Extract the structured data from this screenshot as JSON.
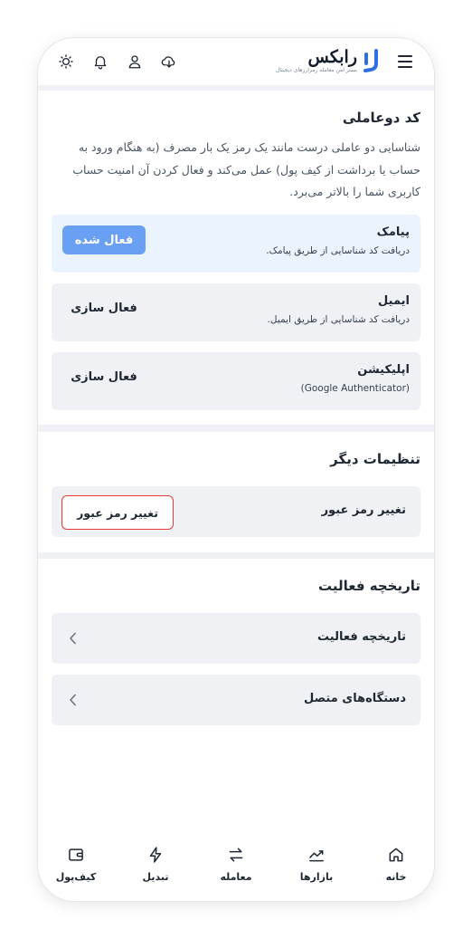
{
  "header": {
    "logo_text": "رابکس",
    "logo_subtitle": "بستر امن معامله رمزارزهای دیجیتال",
    "icons": [
      "theme-icon",
      "bell-icon",
      "user-icon",
      "cloud-download-icon",
      "hamburger-menu-icon"
    ]
  },
  "two_factor": {
    "title": "کد دوعاملی",
    "description": "شناسایی دو عاملی درست مانند یک رمز یک بار مصرف (به هنگام ورود به حساب یا برداشت از کیف پول) عمل می‌کند و فعال کردن آن امنیت حساب کاربری شما را بالاتر می‌برد.",
    "methods": [
      {
        "title": "پیامک",
        "subtitle": "دریافت کد شناسایی از طریق پیامک.",
        "button": "فعال شده"
      },
      {
        "title": "ایمیل",
        "subtitle": "دریافت کد شناسایی از طریق ایمیل.",
        "button": "فعال سازی"
      },
      {
        "title": "اپلیکیشن",
        "subtitle": "(Google Authenticator)",
        "button": "فعال سازی"
      }
    ]
  },
  "other_settings": {
    "title": "تنظیمات دیگر",
    "change_password_label": "تغییر رمز عبور",
    "change_password_button": "تغییر رمز عبور"
  },
  "activity": {
    "title": "تاریخچه فعالیت",
    "items": [
      {
        "label": "تاریخچه فعالیت"
      },
      {
        "label": "دستگاه‌های متصل"
      }
    ]
  },
  "bottom_nav": [
    {
      "label": "خانه",
      "icon": "home-icon"
    },
    {
      "label": "بازارها",
      "icon": "chart-trend-icon"
    },
    {
      "label": "معامله",
      "icon": "swap-arrows-icon"
    },
    {
      "label": "تبدیل",
      "icon": "lightning-icon"
    },
    {
      "label": "کیف‌پول",
      "icon": "wallet-icon"
    }
  ],
  "colors": {
    "accent": "#6aa0f3",
    "active_card_bg": "#eaf3fe",
    "highlight_border": "#e53935",
    "page_bg": "#eff1f4"
  }
}
